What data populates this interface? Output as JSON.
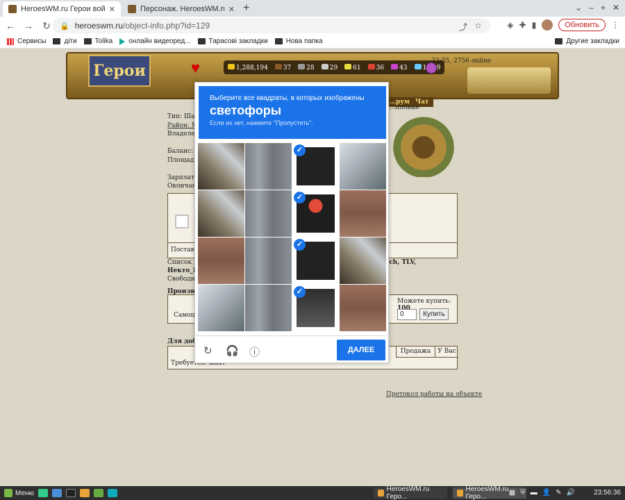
{
  "browser": {
    "tabs": [
      {
        "title": "HeroesWM.ru Герои войны и"
      },
      {
        "title": "Персонаж. HeroesWM.ru Герои"
      }
    ],
    "url_host": "heroeswm.ru",
    "url_path": "/object-info.php?id=129",
    "update_label": "Обновить",
    "bookmarks": [
      "Сервисы",
      "діти",
      "Tolika",
      "онлайн видеоред...",
      "Тарасові закладки",
      "Нова папка"
    ],
    "other_bookmarks": "Другие закладки"
  },
  "game": {
    "logo_text": "Герои",
    "resources": [
      "1,288,194",
      "37",
      "28",
      "29",
      "61",
      "36",
      "43",
      "103.9"
    ],
    "online": "23:55, 2756 online",
    "menu_visible": [
      "…рум",
      "Чат"
    ],
    "corner_text": "…пповые",
    "info_lines": [
      "Тип: Шахт",
      "Район: Mi",
      "Владелец:",
      "",
      "Баланс:",
      "Площадь:",
      "",
      "Зарплата:",
      "Окончани"
    ],
    "supply_label": "Поставщ",
    "list_line1": "Список ра",
    "list_line1_right": "…ych, TLV,",
    "list_line2": "Некто_К",
    "list_line3": "Свободны",
    "prod_title": "Произвед",
    "can_buy": "Можете купить:",
    "can_buy_value": "100",
    "product_name": "Самоцв",
    "qty_value": "0",
    "buy_label": "Купить",
    "ext_title": "Для добы",
    "ext_cols": [
      "Продажа",
      "У Вас"
    ],
    "ext_row": "Требуется: шахт",
    "protocol_link": "Протокол работы на объекте"
  },
  "captcha": {
    "line1": "Выберите все квадраты, в которых изображены",
    "line2": "светофоры",
    "line3": "Если их нет, нажмите \"Пропустить\".",
    "next_label": "ДАЛЕЕ",
    "selected_tiles": [
      2,
      6,
      10,
      14
    ]
  },
  "taskbar": {
    "menu_label": "Меню",
    "tasks": [
      "HeroesWM.ru Геро...",
      "HeroesWM.ru Геро..."
    ],
    "clock": "23:56:36"
  }
}
